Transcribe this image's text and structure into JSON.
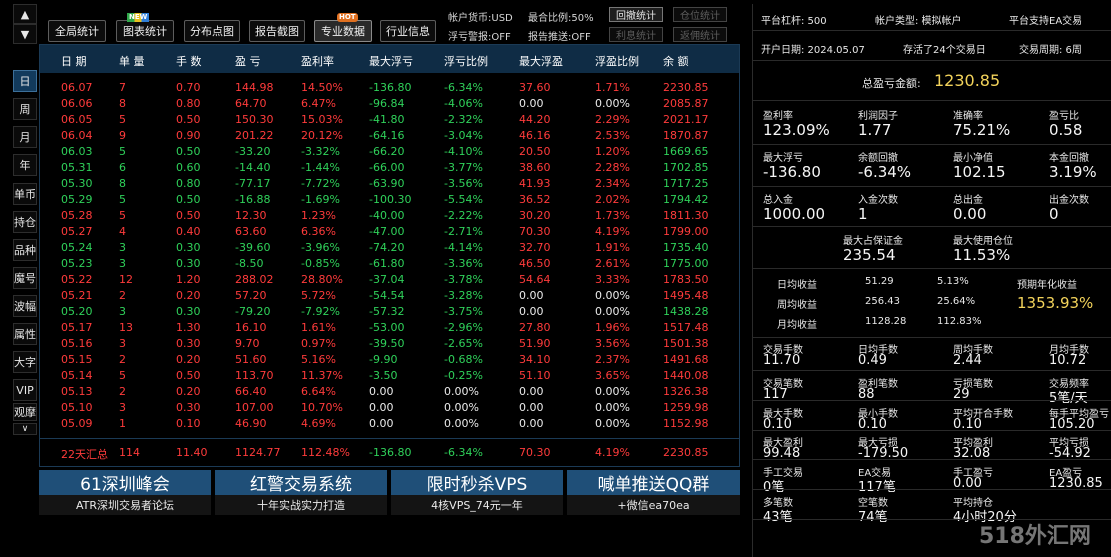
{
  "toolbar": {
    "up_arrow": "▲",
    "down_arrow": "▼",
    "buttons": [
      {
        "label": "全局统计"
      },
      {
        "label": "图表统计",
        "badge": "NEW"
      },
      {
        "label": "分布点图"
      },
      {
        "label": "报告截图"
      },
      {
        "label": "专业数据",
        "badge": "HOT"
      },
      {
        "label": "行业信息"
      }
    ],
    "account_currency": "帐户货币:USD",
    "max_ratio": "最合比例:50%",
    "float_alert": "浮亏警报:OFF",
    "report_push": "报告推送:OFF",
    "toggles": [
      "回撤统计",
      "仓位统计",
      "利息统计",
      "返佣统计"
    ]
  },
  "left_nav": [
    "日",
    "周",
    "月",
    "年",
    "单币",
    "持仓",
    "品种",
    "魔号",
    "波幅",
    "属性",
    "大字",
    "VIP",
    "观摩",
    "∨"
  ],
  "colors": {
    "profit": "#ff3b3b",
    "loss": "#2fd15a",
    "neutral": "#eaeaea",
    "header_bg": "#0f2c45",
    "accent_yellow": "#f3d35b",
    "promo_bg": "#1f4f78"
  },
  "table": {
    "headers": [
      "日 期",
      "单 量",
      "手 数",
      "盈 亏",
      "盈利率",
      "最大浮亏",
      "浮亏比例",
      "最大浮盈",
      "浮盈比例",
      "余 额"
    ],
    "rows": [
      {
        "color": "red",
        "cells": [
          "06.07",
          "7",
          "0.70",
          "144.98",
          "14.50%",
          "-136.80",
          "-6.34%",
          "37.60",
          "1.71%",
          "2230.85"
        ]
      },
      {
        "color": "red",
        "cells": [
          "06.06",
          "8",
          "0.80",
          "64.70",
          "6.47%",
          "-96.84",
          "-4.06%",
          "0.00",
          "0.00%",
          "2085.87"
        ]
      },
      {
        "color": "red",
        "cells": [
          "06.05",
          "5",
          "0.50",
          "150.30",
          "15.03%",
          "-41.80",
          "-2.32%",
          "44.20",
          "2.29%",
          "2021.17"
        ]
      },
      {
        "color": "red",
        "cells": [
          "06.04",
          "9",
          "0.90",
          "201.22",
          "20.12%",
          "-64.16",
          "-3.04%",
          "46.16",
          "2.53%",
          "1870.87"
        ]
      },
      {
        "color": "green",
        "cells": [
          "06.03",
          "5",
          "0.50",
          "-33.20",
          "-3.32%",
          "-66.20",
          "-4.10%",
          "20.50",
          "1.20%",
          "1669.65"
        ]
      },
      {
        "color": "green",
        "cells": [
          "05.31",
          "6",
          "0.60",
          "-14.40",
          "-1.44%",
          "-66.00",
          "-3.77%",
          "38.60",
          "2.28%",
          "1702.85"
        ]
      },
      {
        "color": "green",
        "cells": [
          "05.30",
          "8",
          "0.80",
          "-77.17",
          "-7.72%",
          "-63.90",
          "-3.56%",
          "41.93",
          "2.34%",
          "1717.25"
        ]
      },
      {
        "color": "green",
        "cells": [
          "05.29",
          "5",
          "0.50",
          "-16.88",
          "-1.69%",
          "-100.30",
          "-5.54%",
          "36.52",
          "2.02%",
          "1794.42"
        ]
      },
      {
        "color": "red",
        "cells": [
          "05.28",
          "5",
          "0.50",
          "12.30",
          "1.23%",
          "-40.00",
          "-2.22%",
          "30.20",
          "1.73%",
          "1811.30"
        ]
      },
      {
        "color": "red",
        "cells": [
          "05.27",
          "4",
          "0.40",
          "63.60",
          "6.36%",
          "-47.00",
          "-2.71%",
          "70.30",
          "4.19%",
          "1799.00"
        ]
      },
      {
        "color": "green",
        "cells": [
          "05.24",
          "3",
          "0.30",
          "-39.60",
          "-3.96%",
          "-74.20",
          "-4.14%",
          "32.70",
          "1.91%",
          "1735.40"
        ]
      },
      {
        "color": "green",
        "cells": [
          "05.23",
          "3",
          "0.30",
          "-8.50",
          "-0.85%",
          "-61.80",
          "-3.36%",
          "46.50",
          "2.61%",
          "1775.00"
        ]
      },
      {
        "color": "red",
        "cells": [
          "05.22",
          "12",
          "1.20",
          "288.02",
          "28.80%",
          "-37.04",
          "-3.78%",
          "54.64",
          "3.33%",
          "1783.50"
        ]
      },
      {
        "color": "red",
        "cells": [
          "05.21",
          "2",
          "0.20",
          "57.20",
          "5.72%",
          "-54.54",
          "-3.28%",
          "0.00",
          "0.00%",
          "1495.48"
        ]
      },
      {
        "color": "green",
        "cells": [
          "05.20",
          "3",
          "0.30",
          "-79.20",
          "-7.92%",
          "-57.32",
          "-3.75%",
          "0.00",
          "0.00%",
          "1438.28"
        ]
      },
      {
        "color": "red",
        "cells": [
          "05.17",
          "13",
          "1.30",
          "16.10",
          "1.61%",
          "-53.00",
          "-2.96%",
          "27.80",
          "1.96%",
          "1517.48"
        ]
      },
      {
        "color": "red",
        "cells": [
          "05.16",
          "3",
          "0.30",
          "9.70",
          "0.97%",
          "-39.50",
          "-2.65%",
          "51.90",
          "3.56%",
          "1501.38"
        ]
      },
      {
        "color": "red",
        "cells": [
          "05.15",
          "2",
          "0.20",
          "51.60",
          "5.16%",
          "-9.90",
          "-0.68%",
          "34.10",
          "2.37%",
          "1491.68"
        ]
      },
      {
        "color": "red",
        "cells": [
          "05.14",
          "5",
          "0.50",
          "113.70",
          "11.37%",
          "-3.50",
          "-0.25%",
          "51.10",
          "3.65%",
          "1440.08"
        ]
      },
      {
        "color": "red",
        "cells": [
          "05.13",
          "2",
          "0.20",
          "66.40",
          "6.64%",
          "0.00",
          "0.00%",
          "0.00",
          "0.00%",
          "1326.38"
        ]
      },
      {
        "color": "red",
        "cells": [
          "05.10",
          "3",
          "0.30",
          "107.00",
          "10.70%",
          "0.00",
          "0.00%",
          "0.00",
          "0.00%",
          "1259.98"
        ]
      },
      {
        "color": "red",
        "cells": [
          "05.09",
          "1",
          "0.10",
          "46.90",
          "4.69%",
          "0.00",
          "0.00%",
          "0.00",
          "0.00%",
          "1152.98"
        ]
      }
    ],
    "summary": [
      "22天汇总",
      "114",
      "11.40",
      "1124.77",
      "112.48%",
      "-136.80",
      "-6.34%",
      "70.30",
      "4.19%",
      "2230.85"
    ]
  },
  "promos": [
    {
      "title": "61深圳峰会",
      "sub": "ATR深圳交易者论坛"
    },
    {
      "title": "红警交易系统",
      "sub": "十年实战实力打造"
    },
    {
      "title": "限时秒杀VPS",
      "sub": "4核VPS_74元一年"
    },
    {
      "title": "喊单推送QQ群",
      "sub": "+微信ea70ea"
    }
  ],
  "right": {
    "leverage": "平台杠杆:  500",
    "account_type": "帐户类型:  模拟帐户",
    "ea_support": "平台支持EA交易",
    "open_date": "开户日期:  2024.05.07",
    "survive": "存活了24个交易日",
    "trade_cycle": "交易周期:  6周",
    "total_label": "总盈亏金额:",
    "total_value": "1230.85",
    "grid1": [
      {
        "label": "盈利率",
        "value": "123.09%"
      },
      {
        "label": "利润因子",
        "value": "1.77"
      },
      {
        "label": "准确率",
        "value": "75.21%"
      },
      {
        "label": "盈亏比",
        "value": "0.58"
      },
      {
        "label": "最大浮亏",
        "value": "-136.80"
      },
      {
        "label": "余额回撤",
        "value": "-6.34%"
      },
      {
        "label": "最小净值",
        "value": "102.15"
      },
      {
        "label": "本金回撤",
        "value": "3.19%"
      },
      {
        "label": "总入金",
        "value": "1000.00"
      },
      {
        "label": "入金次数",
        "value": "1"
      },
      {
        "label": "总出金",
        "value": "0.00"
      },
      {
        "label": "出金次数",
        "value": "0"
      }
    ],
    "margin_label": "最大占保证金",
    "margin_value": "235.54",
    "pos_label": "最大使用仓位",
    "pos_value": "11.53%",
    "daily_label": "日均收益",
    "daily_val": "51.29",
    "daily_pct": "5.13%",
    "weekly_label": "周均收益",
    "weekly_val": "256.43",
    "weekly_pct": "25.64%",
    "monthly_label": "月均收益",
    "monthly_val": "1128.28",
    "monthly_pct": "112.83%",
    "annual_label": "预期年化收益",
    "annual_value": "1353.93%",
    "grid2": [
      {
        "label": "交易手数",
        "value": "11.70"
      },
      {
        "label": "日均手数",
        "value": "0.49"
      },
      {
        "label": "周均手数",
        "value": "2.44"
      },
      {
        "label": "月均手数",
        "value": "10.72"
      },
      {
        "label": "交易笔数",
        "value": "117"
      },
      {
        "label": "盈利笔数",
        "value": "88"
      },
      {
        "label": "亏损笔数",
        "value": "29"
      },
      {
        "label": "交易频率",
        "value": "5笔/天"
      },
      {
        "label": "最大手数",
        "value": "0.10"
      },
      {
        "label": "最小手数",
        "value": "0.10"
      },
      {
        "label": "平均开合手数",
        "value": "0.10"
      },
      {
        "label": "每手平均盈亏",
        "value": "105.20"
      },
      {
        "label": "最大盈利",
        "value": "99.48"
      },
      {
        "label": "最大亏损",
        "value": "-179.50"
      },
      {
        "label": "平均盈利",
        "value": "32.08"
      },
      {
        "label": "平均亏损",
        "value": "-54.92"
      },
      {
        "label": "手工交易",
        "value": "0笔"
      },
      {
        "label": "EA交易",
        "value": "117笔"
      },
      {
        "label": "手工盈亏",
        "value": "0.00"
      },
      {
        "label": "EA盈亏",
        "value": "1230.85"
      },
      {
        "label": "多笔数",
        "value": "43笔"
      },
      {
        "label": "空笔数",
        "value": "74笔"
      },
      {
        "label": "平均持仓",
        "value": "4小时20分"
      },
      {
        "label": "",
        "value": ""
      }
    ]
  },
  "watermark": "518外汇网"
}
